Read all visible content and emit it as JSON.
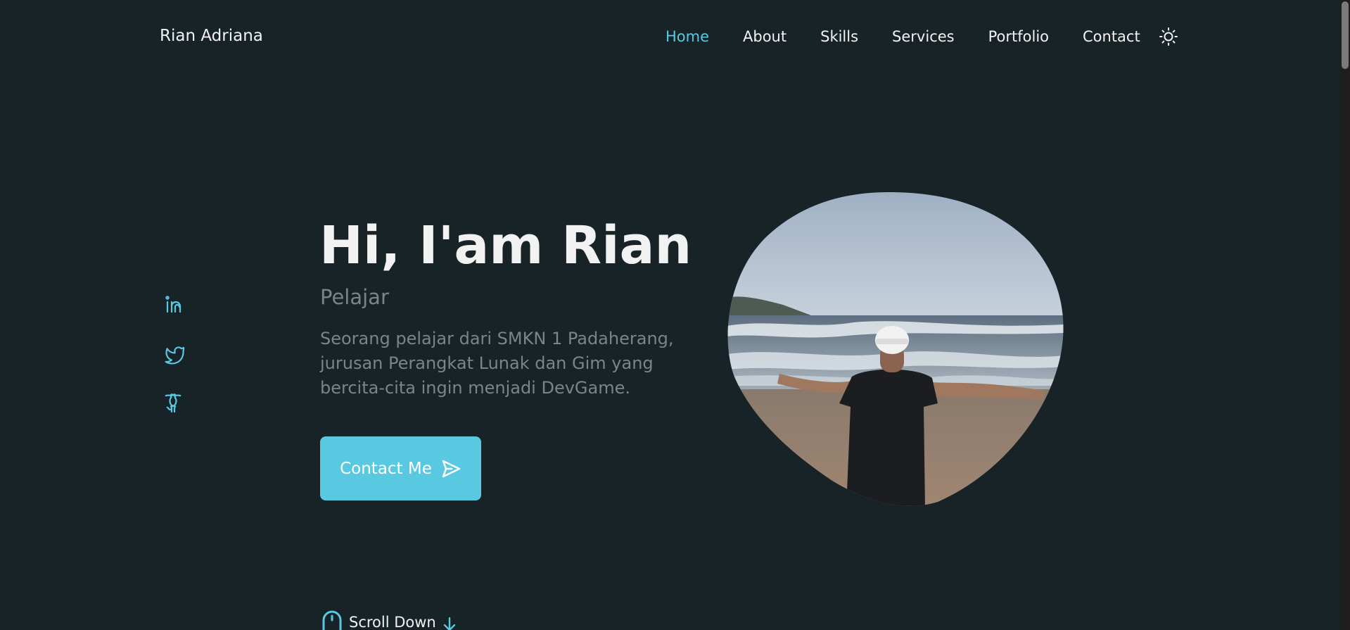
{
  "header": {
    "logo": "Rian Adriana",
    "nav": [
      {
        "label": "Home",
        "active": true
      },
      {
        "label": "About",
        "active": false
      },
      {
        "label": "Skills",
        "active": false
      },
      {
        "label": "Services",
        "active": false
      },
      {
        "label": "Portfolio",
        "active": false
      },
      {
        "label": "Contact",
        "active": false
      }
    ],
    "theme_icon": "sun-icon"
  },
  "social": [
    "linkedin-icon",
    "twitter-icon",
    "github-icon"
  ],
  "hero": {
    "title": "Hi, I'am Rian",
    "subtitle": "Pelajar",
    "description": "Seorang pelajar dari SMKN 1 Padaherang, jurusan Perangkat Lunak dan Gim yang bercita-cita ingin menjadi DevGame.",
    "button_label": "Contact Me",
    "button_icon": "send-icon"
  },
  "scroll": {
    "label": "Scroll Down",
    "mouse_icon": "mouse-icon",
    "arrow_icon": "arrow-down-icon"
  },
  "colors": {
    "background": "#182327",
    "accent": "#58c9e1",
    "text": "#f2f2f2",
    "muted": "#7b8487"
  }
}
